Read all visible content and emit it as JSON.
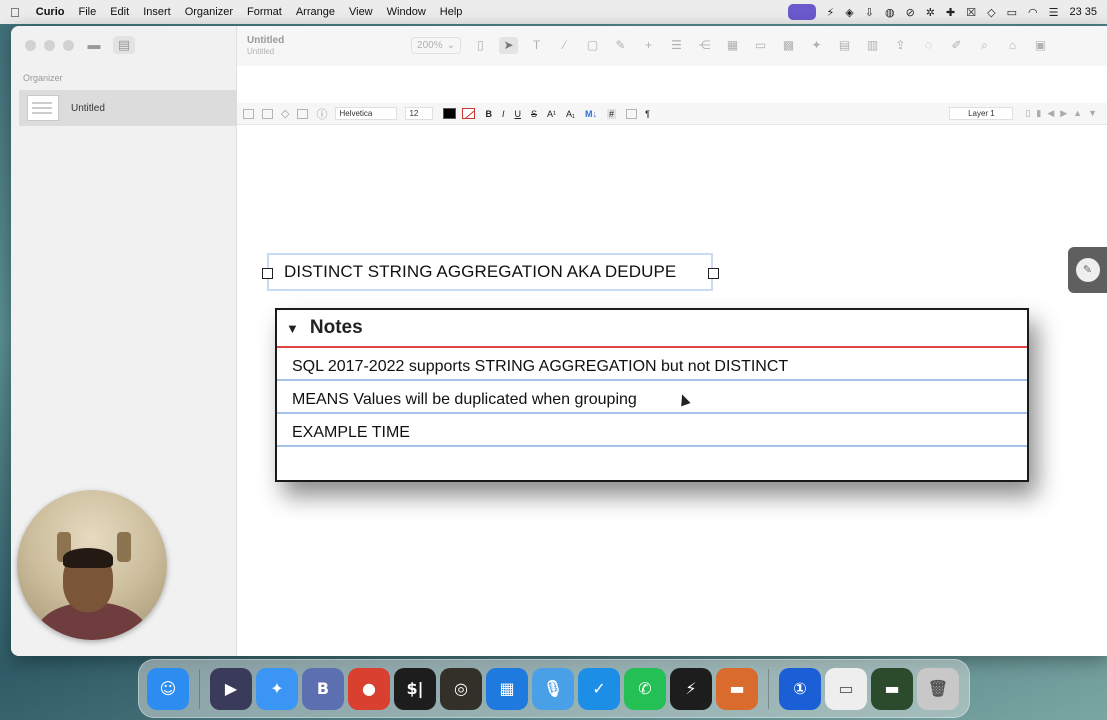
{
  "menubar": {
    "apple": "",
    "items": [
      "Curio",
      "File",
      "Edit",
      "Insert",
      "Organizer",
      "Format",
      "Arrange",
      "View",
      "Window",
      "Help"
    ],
    "clock": "23 35"
  },
  "sidebar": {
    "organizer_label": "Organizer",
    "items": [
      {
        "label": "Untitled"
      }
    ]
  },
  "toolbar": {
    "title": "Untitled",
    "subtitle": "Untitled",
    "zoom": "200%"
  },
  "formatbar": {
    "font": "Helvetica",
    "size": "12",
    "bold": "B",
    "italic": "I",
    "underline": "U",
    "strike": "S",
    "superscript": "A¹",
    "subscript": "A₁",
    "markdown": "M↓",
    "hash": "#",
    "pilcrow": "¶",
    "layer": "Layer 1"
  },
  "canvas": {
    "heading": "DISTINCT STRING AGGREGATION AKA DEDUPE",
    "notes": {
      "title": "Notes",
      "rows": [
        "SQL 2017-2022 supports STRING AGGREGATION but not DISTINCT",
        "MEANS Values will be duplicated when grouping",
        "EXAMPLE TIME",
        ""
      ]
    }
  },
  "help": "?",
  "dock": {
    "apps": [
      {
        "name": "finder",
        "glyph": "☺",
        "color": "#2d8cf0"
      },
      {
        "name": "app-2",
        "glyph": "▶",
        "color": "#3a3a5a"
      },
      {
        "name": "safari",
        "glyph": "✦",
        "color": "#3b95f5"
      },
      {
        "name": "bbedit",
        "glyph": "B",
        "color": "#5c6fb0"
      },
      {
        "name": "chrome",
        "glyph": "●",
        "color": "#d9402f"
      },
      {
        "name": "terminal",
        "glyph": "$|",
        "color": "#1d1d1d"
      },
      {
        "name": "app-7",
        "glyph": "◎",
        "color": "#33302a"
      },
      {
        "name": "app-8",
        "glyph": "▦",
        "color": "#1f7ae0"
      },
      {
        "name": "app-9",
        "glyph": "🎙",
        "color": "#4aa0e6"
      },
      {
        "name": "app-10",
        "glyph": "✓",
        "color": "#1d8ee6"
      },
      {
        "name": "whatsapp",
        "glyph": "✆",
        "color": "#25c055"
      },
      {
        "name": "app-12",
        "glyph": "⚡",
        "color": "#1d1d1d"
      },
      {
        "name": "app-13",
        "glyph": "▬",
        "color": "#d96b2c"
      }
    ],
    "extras": [
      {
        "name": "1password",
        "glyph": "①",
        "color": "#1a5fd6"
      },
      {
        "name": "stack-1",
        "glyph": "▭",
        "color": "#eeeeee"
      },
      {
        "name": "stack-2",
        "glyph": "▬",
        "color": "#2c4a2c"
      },
      {
        "name": "trash",
        "glyph": "🗑",
        "color": "#c8c8c8"
      }
    ]
  }
}
